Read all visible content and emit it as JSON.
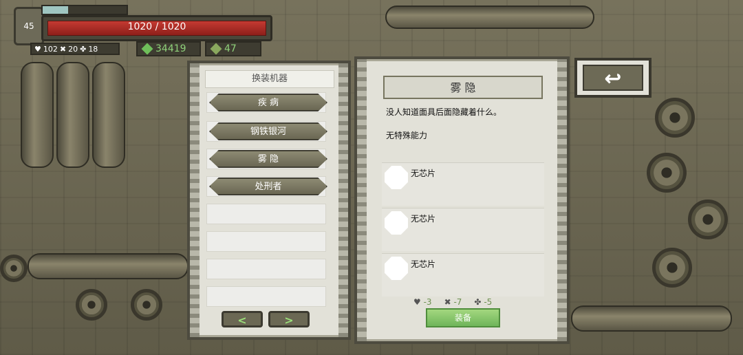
{
  "hud": {
    "level": "45",
    "hp_text": "1020 / 1020",
    "stats": {
      "heart": "102",
      "cross": "20",
      "clover": "18"
    },
    "currency_gems": "34419",
    "currency_chips": "47"
  },
  "mech_panel": {
    "title": "换装机器",
    "items": [
      "疾 病",
      "钢铁银河",
      "雾 隐",
      "处刑者"
    ],
    "prev_label": "<",
    "next_label": ">"
  },
  "detail": {
    "name": "雾 隐",
    "description": "没人知道面具后面隐藏着什么。",
    "ability": "无特殊能力",
    "chips": [
      "无芯片",
      "无芯片",
      "无芯片"
    ],
    "costs": {
      "heart": "-3",
      "cross": "-7",
      "clover": "-5"
    },
    "equip_label": "装备"
  },
  "return_label": "↩",
  "colors": {
    "hp": "#c43a32",
    "accent_green": "#6fb55a",
    "panel": "#e2e1d8"
  }
}
